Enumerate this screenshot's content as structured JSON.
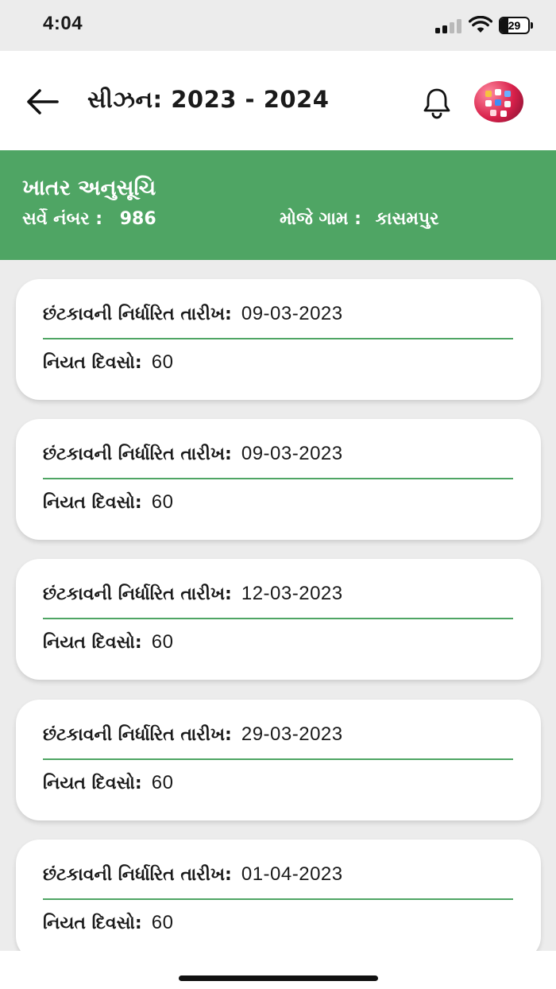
{
  "status_bar": {
    "time": "4:04",
    "battery": "29",
    "battery_level": 0.29
  },
  "header": {
    "back_icon": "arrow-left-icon",
    "title": "સીઝન: 2023 - 2024",
    "notification_icon": "bell-icon",
    "avatar_icon": "profile-avatar"
  },
  "banner": {
    "title": "ખાતર અનુસૂચિ",
    "survey_label": "સર્વે નંબર :",
    "survey_value": "986",
    "village_label": "મોજે ગામ :",
    "village_value": "કાસમપુર",
    "color": "#4fa564"
  },
  "cards": [
    {
      "date_label": "છંટકાવની નિર્ધારિત તારીખ:",
      "date": "09-03-2023",
      "days_label": "નિયત દિવસો:",
      "days": "60"
    },
    {
      "date_label": "છંટકાવની નિર્ધારિત તારીખ:",
      "date": "09-03-2023",
      "days_label": "નિયત દિવસો:",
      "days": "60"
    },
    {
      "date_label": "છંટકાવની નિર્ધારિત તારીખ:",
      "date": "12-03-2023",
      "days_label": "નિયત દિવસો:",
      "days": "60"
    },
    {
      "date_label": "છંટકાવની નિર્ધારિત તારીખ:",
      "date": "29-03-2023",
      "days_label": "નિયત દિવસો:",
      "days": "60"
    },
    {
      "date_label": "છંટકાવની નિર્ધારિત તારીખ:",
      "date": "01-04-2023",
      "days_label": "નિયત દિવસો:",
      "days": "60"
    }
  ]
}
